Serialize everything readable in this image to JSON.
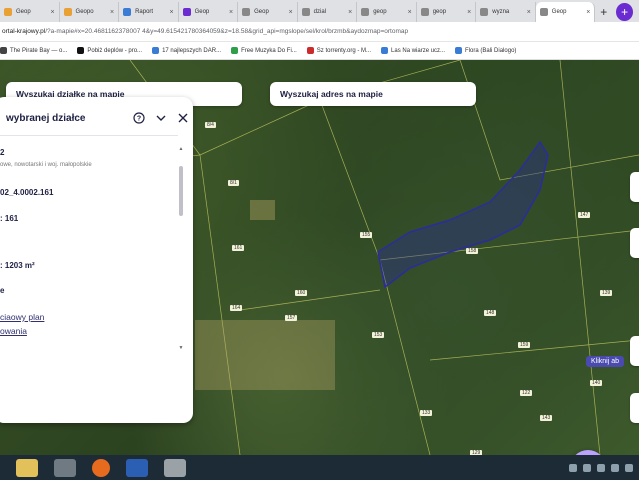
{
  "browser": {
    "tabs": [
      {
        "title": "Geop",
        "color": "#e9a136"
      },
      {
        "title": "Geopo",
        "color": "#e9a136"
      },
      {
        "title": "Raport",
        "color": "#3a7bd5"
      },
      {
        "title": "Geop",
        "color": "#6a2bd0"
      },
      {
        "title": "Geop",
        "color": "#888888"
      },
      {
        "title": "dzial",
        "color": "#888888"
      },
      {
        "title": "geop",
        "color": "#888888"
      },
      {
        "title": "geop",
        "color": "#888888"
      },
      {
        "title": "wyzna",
        "color": "#888888"
      },
      {
        "title": "Geop",
        "color": "#888888"
      }
    ],
    "url_domain": "ortal-krajowy.pl",
    "url_rest": "/?a-mapie#x=20.4681162378007 4&y=49.615421780364059&z=18.58&grid_api=mgslope/sel/krol/brzmb&aydozmap=ortomap",
    "bookmarks": [
      {
        "label": "The Pirate Bay — o...",
        "color": "#444444"
      },
      {
        "label": "Pobiż deplów - pro...",
        "color": "#111111"
      },
      {
        "label": "17 najlepszych DAR...",
        "color": "#3a7bd5"
      },
      {
        "label": "Free Muzyka Do Fi...",
        "color": "#2e9e48"
      },
      {
        "label": "Sz torrenty.org - M...",
        "color": "#cc2b2b"
      },
      {
        "label": "Las Na wiarze ucz...",
        "color": "#3a7bd5"
      },
      {
        "label": "Flora (Bali Dialogo)",
        "color": "#3a7bd5"
      }
    ]
  },
  "map": {
    "search_parcel": "Wyszukaj działkę na mapie",
    "search_address": "Wyszukaj adres na mapie",
    "parcel_numbers": [
      "8/4",
      "8/1",
      "161",
      "164",
      "160",
      "157",
      "158",
      "147",
      "155",
      "153",
      "148",
      "159",
      "143",
      "140",
      "139",
      "133",
      "129",
      "122"
    ],
    "side_label": "Kliknij ab"
  },
  "panel": {
    "title": "wybranej działce",
    "line1": "2",
    "line1_small": "owe, nowotarski i woj. małopolskie",
    "line2": "02_4.0002.161",
    "line3": ": 161",
    "line4": ": 1203 m²",
    "line5": "e",
    "link1": "ciaowy plan",
    "link2": "owania"
  }
}
